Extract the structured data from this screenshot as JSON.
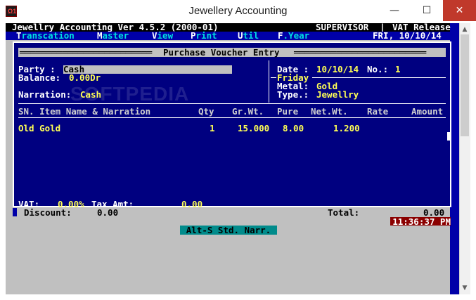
{
  "window": {
    "title": "Jewellery Accounting",
    "app_icon_text": "Ω1",
    "controls": {
      "minimize": "—",
      "maximize": "☐",
      "close": "✕"
    }
  },
  "header": {
    "app_version": "Jewellry Accounting Ver 4.5.2 (2000-01)",
    "role": "SUPERVISOR",
    "separator": "|",
    "release": "VAT Release"
  },
  "menu": {
    "items": [
      {
        "key": "T",
        "rest": "ranscation"
      },
      {
        "key": "M",
        "rest": "aster"
      },
      {
        "key": "V",
        "rest": "iew"
      },
      {
        "key": "P",
        "rest": "rint"
      },
      {
        "key": "U",
        "rest": "til"
      },
      {
        "key": "F",
        "rest": ".Year"
      }
    ],
    "date": "FRI, 10/10/14"
  },
  "form": {
    "title": "Purchase Voucher Entry",
    "party_label": "Party :",
    "party_value": "Cash",
    "balance_label": "Balance:",
    "balance_value": "0.00Dr",
    "narration_label": "Narration:",
    "narration_value": "Cash",
    "date_label": "Date :",
    "date_value": "10/10/14",
    "no_label": "No.:",
    "no_value": "1",
    "day": "Friday",
    "metal_label": "Metal:",
    "metal_value": "Gold",
    "type_label": "Type.:",
    "type_value": "Jewellry"
  },
  "table": {
    "columns": [
      "SN. Item Name & Narration",
      "Qty",
      "Gr.Wt.",
      "Pure",
      "Net.Wt.",
      "Rate",
      "Amount"
    ],
    "rows": [
      {
        "item": "Old Gold",
        "qty": "1",
        "gr_wt": "15.000",
        "pure": "8.00",
        "net_wt": "1.200",
        "rate": "",
        "amount": ""
      }
    ]
  },
  "totals": {
    "vat_label": "VAT:",
    "vat_value": "0.00%",
    "tax_label": "Tax Amt:",
    "tax_value": "0.00",
    "discount_label": "Discount:",
    "discount_value": "0.00",
    "total_label": "Total:",
    "total_value": "0.00"
  },
  "status": {
    "clock": "11:36:37 PM",
    "hint": "Alt-S Std. Narr."
  },
  "watermark": "SOFTPEDIA",
  "colors": {
    "menu_bg": "#0000a8",
    "form_bg": "#000080",
    "value_yellow": "#ffff55",
    "menu_cyan": "#00e0e0",
    "clock_bg": "#8b0000",
    "hint_bg": "#008b8b",
    "close_red": "#c0392b"
  }
}
